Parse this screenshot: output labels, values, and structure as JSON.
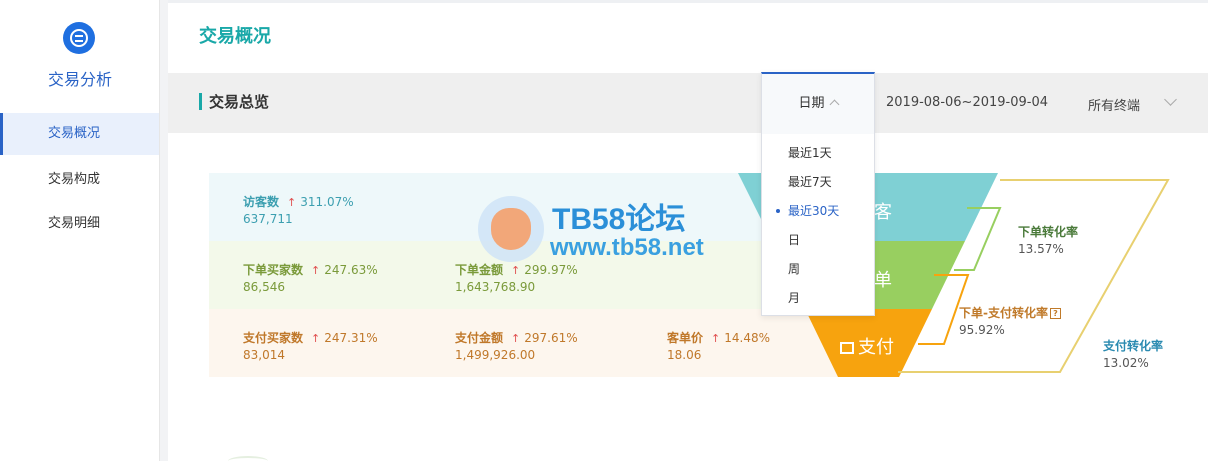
{
  "sidebar": {
    "title": "交易分析",
    "items": [
      {
        "label": "交易概况",
        "active": true
      },
      {
        "label": "交易构成",
        "active": false
      },
      {
        "label": "交易明细",
        "active": false
      }
    ]
  },
  "header": {
    "page_title": "交易概况",
    "section_title": "交易总览",
    "date_range": "2019-08-06~2019-09-04",
    "terminal": "所有终端"
  },
  "date_dropdown": {
    "label": "日期",
    "selected": "最近30天",
    "options": [
      "最近1天",
      "最近7天",
      "最近30天",
      "日",
      "周",
      "月"
    ]
  },
  "metrics": {
    "visitors": {
      "label": "访客数",
      "pct": "311.07%",
      "value": "637,711"
    },
    "order_buyers": {
      "label": "下单买家数",
      "pct": "247.63%",
      "value": "86,546"
    },
    "order_amount": {
      "label": "下单金额",
      "pct": "299.97%",
      "value": "1,643,768.90"
    },
    "pay_buyers": {
      "label": "支付买家数",
      "pct": "247.31%",
      "value": "83,014"
    },
    "pay_amount": {
      "label": "支付金额",
      "pct": "297.61%",
      "value": "1,499,926.00"
    },
    "unit_price": {
      "label": "客单价",
      "pct": "14.48%",
      "value": "18.06"
    }
  },
  "funnel": {
    "stage_visit": "客",
    "stage_order": "单",
    "stage_pay": "支付",
    "conv_order": {
      "label": "下单转化率",
      "value": "13.57%"
    },
    "conv_order_pay": {
      "label": "下单-支付转化率",
      "value": "95.92%"
    },
    "conv_pay": {
      "label": "支付转化率",
      "value": "13.02%"
    }
  },
  "watermark": {
    "main": "TB58论坛",
    "url": "www.tb58.net"
  },
  "colors": {
    "accent": "#19a8a8",
    "primary_blue": "#2a63c6",
    "funnel_visit": "#7fd0d4",
    "funnel_order": "#98cf60",
    "funnel_pay": "#f7a30e",
    "up_arrow": "#e05050"
  }
}
